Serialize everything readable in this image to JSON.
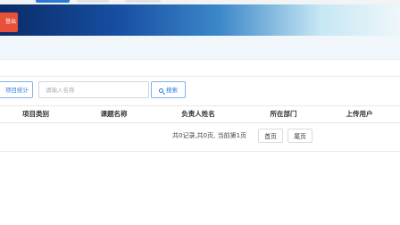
{
  "header": {
    "action_label": "登出"
  },
  "toolbar": {
    "stats_label": "项目统计",
    "search_placeholder": "请输入名称",
    "search_label": "搜索"
  },
  "table": {
    "columns": [
      "项目类别",
      "课题名称",
      "负责人姓名",
      "所在部门",
      "上传用户"
    ]
  },
  "pagination": {
    "info": "共0记录,共0页, 当前第1页",
    "first_label": "首页",
    "last_label": "尾页"
  },
  "colors": {
    "accent": "#2c7be5",
    "header_dark": "#0a2b68",
    "action_red": "#e8503a"
  }
}
